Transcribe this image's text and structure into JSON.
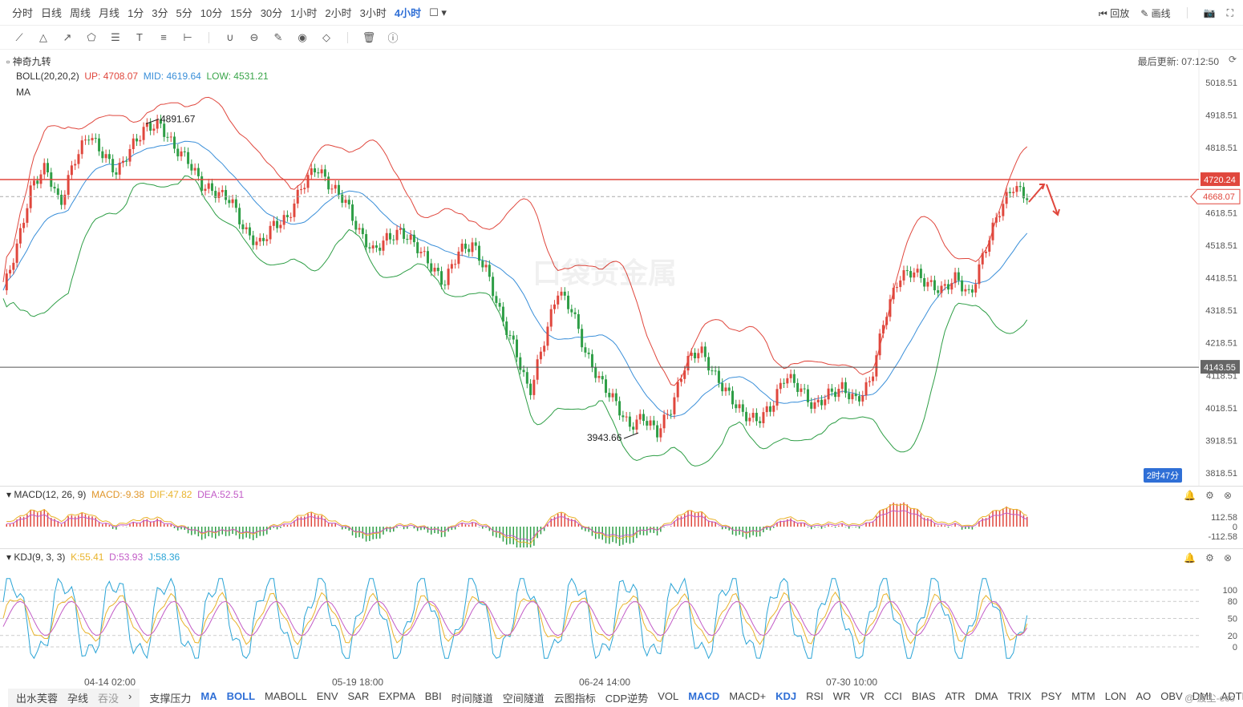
{
  "periods": [
    "分时",
    "日线",
    "周线",
    "月线",
    "1分",
    "3分",
    "5分",
    "10分",
    "15分",
    "30分",
    "1小时",
    "2小时",
    "3小时",
    "4小时"
  ],
  "active_period": "4小时",
  "top_right": {
    "replay": "回放",
    "draw": "画线"
  },
  "overlays": {
    "name": "神奇九转",
    "boll_name": "BOLL(20,20,2)",
    "up": "UP: 4708.07",
    "mid": "MID: 4619.64",
    "low": "LOW: 4531.21",
    "ma": "MA"
  },
  "last_update": "最后更新: 07:12:50",
  "price_ticks": [
    "5018.51",
    "4918.51",
    "4818.51",
    "4718.51",
    "4618.51",
    "4518.51",
    "4418.51",
    "4318.51",
    "4218.51",
    "4118.51",
    "4018.51",
    "3918.51",
    "3818.51"
  ],
  "markers": {
    "high": "4891.67",
    "low": "3943.66",
    "resistance": "4720.24",
    "current": "4668.07",
    "support": "4143.55",
    "countdown": "2时47分"
  },
  "watermark": "口袋贵金属",
  "macd": {
    "label": "MACD(12, 26, 9)",
    "macd": "MACD:-9.38",
    "dif": "DIF:47.82",
    "dea": "DEA:52.51",
    "ticks": [
      "112.58",
      "0",
      "-112.58"
    ]
  },
  "kdj": {
    "label": "KDJ(9, 3, 3)",
    "k": "K:55.41",
    "d": "D:53.93",
    "j": "J:58.36",
    "ticks": [
      "100",
      "80",
      "50",
      "20",
      "0"
    ]
  },
  "time_ticks": [
    "04-14 02:00",
    "05-19 18:00",
    "06-24 14:00",
    "07-30 10:00"
  ],
  "bottom_left": [
    "出水芙蓉",
    "孕线",
    "吞没"
  ],
  "indicators": [
    "支撑压力",
    "MA",
    "BOLL",
    "MABOLL",
    "ENV",
    "SAR",
    "EXPMA",
    "BBI",
    "时间隧道",
    "空间隧道",
    "云图指标",
    "CDP逆势",
    "VOL",
    "MACD",
    "MACD+",
    "KDJ",
    "RSI",
    "WR",
    "VR",
    "CCI",
    "BIAS",
    "ATR",
    "DMA",
    "TRIX",
    "PSY",
    "MTM",
    "LON",
    "AO",
    "OBV",
    "DMI",
    "ADTM"
  ],
  "active_indicators": [
    "MA",
    "BOLL",
    "MACD",
    "KDJ"
  ],
  "credit": "@ 渡尘-eco",
  "colors": {
    "up": "#e0473d",
    "down": "#2e9e46",
    "mid": "#3a8fd9",
    "accent": "#2f6fd6"
  },
  "chart_data": {
    "type": "candlestick",
    "price_levels": {
      "resistance": 4720.24,
      "current": 4668.07,
      "support": 4143.55
    },
    "ylim": [
      3818.51,
      5018.51
    ],
    "path": [
      4380,
      4520,
      4700,
      4760,
      4640,
      4780,
      4860,
      4800,
      4740,
      4820,
      4880,
      4891.67,
      4820,
      4780,
      4700,
      4680,
      4660,
      4560,
      4520,
      4580,
      4600,
      4700,
      4760,
      4700,
      4660,
      4560,
      4500,
      4540,
      4560,
      4520,
      4460,
      4400,
      4500,
      4520,
      4440,
      4300,
      4200,
      4060,
      4220,
      4380,
      4320,
      4180,
      4100,
      4040,
      3960,
      3990,
      3943.66,
      4020,
      4160,
      4200,
      4120,
      4060,
      4000,
      3980,
      4020,
      4120,
      4080,
      4020,
      4060,
      4080,
      4040,
      4100,
      4300,
      4420,
      4440,
      4400,
      4380,
      4420,
      4360,
      4500,
      4620,
      4700,
      4668.07
    ]
  }
}
